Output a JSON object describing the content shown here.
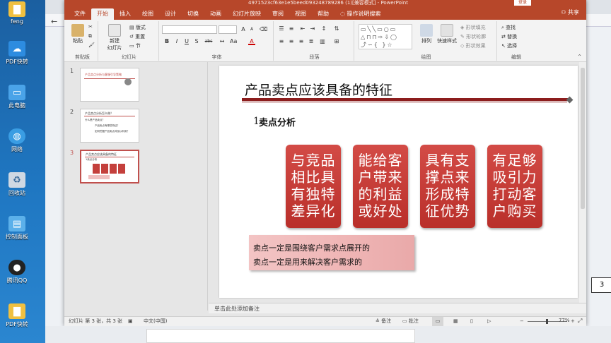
{
  "desktop": {
    "user": "feng",
    "icons": [
      {
        "label": "PDF快转",
        "icon": "cloud-icon"
      },
      {
        "label": "此电脑",
        "icon": "computer-icon"
      },
      {
        "label": "网络",
        "icon": "globe-icon"
      },
      {
        "label": "回收站",
        "icon": "recycle-bin-icon"
      },
      {
        "label": "控制面板",
        "icon": "control-panel-icon"
      },
      {
        "label": "腾讯QQ",
        "icon": "qq-icon"
      },
      {
        "label": "PDF快转",
        "icon": "folder-icon"
      }
    ]
  },
  "window": {
    "title": "4971523cf63e1e5beed093248789286 (1)[兼容模式] - PowerPoint",
    "login_label": "登录",
    "share_label": "共享",
    "accent_color": "#b7472a"
  },
  "ribbon": {
    "tabs": [
      "文件",
      "开始",
      "插入",
      "绘图",
      "设计",
      "切换",
      "动画",
      "幻灯片放映",
      "审阅",
      "视图",
      "帮助",
      "操作说明搜索"
    ],
    "active_tab": "开始",
    "clipboard": {
      "paste": "粘贴",
      "group": "剪贴板"
    },
    "slides": {
      "new_slide": "新建\n幻灯片",
      "layout": "版式",
      "reset": "重置",
      "section": "节",
      "group": "幻灯片"
    },
    "font": {
      "group": "字体",
      "bold": "B",
      "italic": "I",
      "underline": "U",
      "strike": "S",
      "shadow": "abc",
      "color": "A",
      "size_up": "A",
      "size_down": "A"
    },
    "paragraph": {
      "group": "段落"
    },
    "drawing": {
      "arrange": "排列",
      "quick_styles": "快速样式",
      "fill": "形状填充",
      "outline": "形状轮廓",
      "effects": "形状效果",
      "group": "绘图"
    },
    "editing": {
      "find": "查找",
      "replace": "替换",
      "select": "选择",
      "group": "编辑"
    }
  },
  "thumbnails": {
    "items": [
      {
        "num": "1",
        "title": "产品卖点分析与客服引导策略"
      },
      {
        "num": "2",
        "title": "产品卖点分析怎么做？",
        "lines": [
          "什么是产品卖点？",
          "产品卖点有哪些特征？",
          "如何挖掘产品卖点并加以利用？"
        ]
      },
      {
        "num": "3",
        "title": "产品卖点应该具备的特征",
        "lines": [
          "1卖点分析"
        ]
      }
    ],
    "selected": "3"
  },
  "slide": {
    "title": "产品卖点应该具备的特征",
    "number_prefix": "1",
    "subtitle": "卖点分析",
    "cards": [
      {
        "lines": [
          "与竞品",
          "相比具",
          "有独特",
          "差异化"
        ]
      },
      {
        "lines": [
          "能给客",
          "户带来",
          "的利益",
          "或好处"
        ]
      },
      {
        "lines": [
          "具有支",
          "撑点来",
          "形成特",
          "征优势"
        ]
      },
      {
        "lines": [
          "有足够",
          "吸引力",
          "打动客",
          "户购买"
        ]
      }
    ],
    "note_lines": [
      "卖点一定是围绕客户需求点展开的",
      "卖点一定是用来解决客户需求的"
    ],
    "page_number": "3",
    "card_color": "#c4403c"
  },
  "notes_placeholder": "单击此处添加备注",
  "status": {
    "slide_info": "幻灯片 第 3 张，共 3 张",
    "language": "中文(中国)",
    "notes": "备注",
    "comments": "批注",
    "zoom": "77%"
  }
}
